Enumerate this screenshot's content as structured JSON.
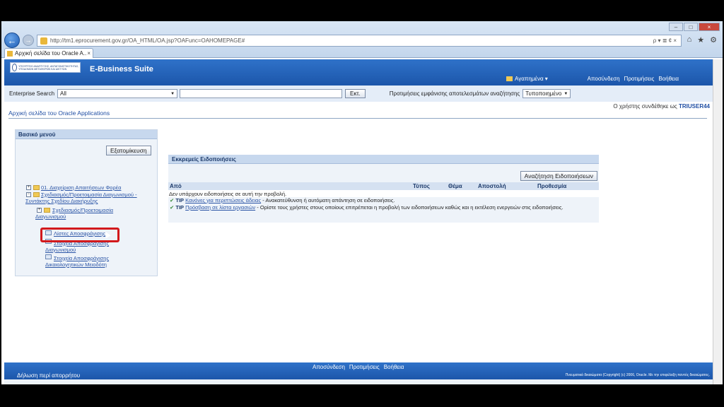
{
  "browser": {
    "url": "http://tm1.eprocurement.gov.gr/OA_HTML/OA.jsp?OAFunc=OAHOMEPAGE#",
    "tab_title": "Αρχική σελίδα του Oracle A...",
    "tab_close": "×",
    "address_tools": "ρ ▾ ≣ ¢ ×",
    "win_min": "–",
    "win_max": "□",
    "win_close": "×"
  },
  "header": {
    "logo_text": "ΥΠΟΥΡΓΕΙΟ ΑΝΑΠΤΥΞΗΣ, ΑΝΤΑΓΩΝΙΣΤΙΚΟΤΗΤΑΣ, ΥΠΟΔΟΜΩΝ ΜΕΤΑΦΟΡΩΝ ΚΑΙ ΔΙΚΤΥΩΝ",
    "suite_title": "E-Business Suite",
    "favorites": "Αγαπημένα ▾",
    "links": [
      "Αποσύνδεση",
      "Προτιμήσεις",
      "Βοήθεια"
    ]
  },
  "search": {
    "label": "Enterprise Search",
    "scope": "All",
    "go_label": "Εκτ.",
    "pref_label": "Προτιμήσεις εμφάνισης αποτελεσμάτων αναζήτησης",
    "pref_value": "Τυποποιημένο"
  },
  "page": {
    "title": "Αρχική σελίδα του Oracle Applications",
    "user_prefix": "Ο χρήστης συνδέθηκε ως",
    "user_name": "TRIUSER44"
  },
  "menu": {
    "heading": "Βασικό μενού",
    "personalize": "Εξατομίκευση",
    "items": [
      "01. Διαχείριση Απαιτήσεων Φορέα",
      "Σχεδιασμός/Προετοιμασία Διαγωνισμού - Συντάκτης Σχεδίου Διακήρυξης",
      "Σχεδιασμός/Προετοιμασία Διαγωνισμού",
      "Λίστες Αποσφράγισης",
      "Στοιχεία Αποσφράγισης Διαγωνισμού",
      "Στοιχεία Αποσφράγισης Δικαιολογητικών Μειοδότη"
    ]
  },
  "notifications": {
    "heading": "Εκκρεμείς Ειδοποιήσεις",
    "adv_search": "Αναζήτηση Ειδοποιήσεων",
    "columns": [
      "Από",
      "Τύπος",
      "Θέμα",
      "Αποστολή",
      "Προθεσμία"
    ],
    "empty_text": "Δεν υπάρχουν ειδοποιήσεις σε αυτή την προβολή.",
    "tips": [
      {
        "label": "TIP",
        "link": "Κανόνες για περιπτώσεις άδειας",
        "text": " - Ανακατεύθυνση ή αυτόματη απάντηση σε ειδοποιήσεις."
      },
      {
        "label": "TIP",
        "link": "Πρόσβαση σε λίστα εργασιών",
        "text": " - Ορίστε τους χρήστες στους οποίους επιτρέπεται η προβολή των ειδοποιήσεων καθώς και η εκτέλεση ενεργειών στις ειδοποιήσεις."
      }
    ]
  },
  "footer": {
    "links": [
      "Αποσύνδεση",
      "Προτιμήσεις",
      "Βοήθεια"
    ],
    "privacy": "Δήλωση περί απορρήτου",
    "copyright": "Πνευματικά δικαιώματα (Copyright) (c) 2006, Oracle. Με την επιφύλαξη παντός δικαιώματος."
  },
  "colors": {
    "header_blue": "#1c56aa",
    "highlight_red": "#d2191c",
    "link_blue": "#2b55a6"
  }
}
